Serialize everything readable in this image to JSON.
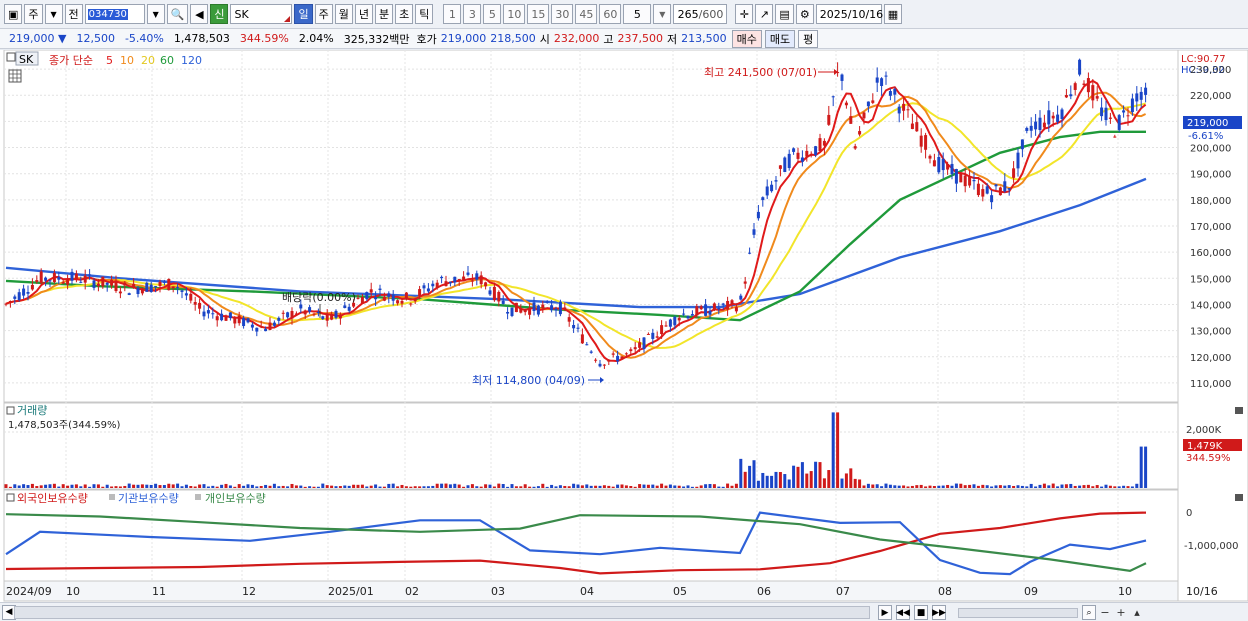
{
  "toolbar": {
    "period_tab": "주",
    "prev_label": "전",
    "code": "034730",
    "stock_name": "SK",
    "new_label": "신",
    "intervals": [
      "일",
      "주",
      "월",
      "년",
      "분",
      "초",
      "틱"
    ],
    "numbers": [
      "1",
      "3",
      "5",
      "10",
      "15",
      "30",
      "45",
      "60"
    ],
    "custom_interval": "5",
    "count": "265",
    "count_max": "/600",
    "date": "2025/10/16"
  },
  "quote": {
    "price": "219,000 ▼",
    "change": "12,500",
    "change_pct": "-5.40%",
    "volume": "1,478,503",
    "volume_ratio": "344.59%",
    "turnover": "2.04%",
    "amount": "325,332백만",
    "bid_label": "호가",
    "bid1": "219,000",
    "bid2": "218,500",
    "open_label": "시",
    "open": "232,000",
    "high_label": "고",
    "high": "237,500",
    "low_label": "저",
    "low": "213,500",
    "buy_label": "매수",
    "sell_label": "매도",
    "avg_label": "평"
  },
  "price_pane": {
    "symbol": "SK",
    "ma_label": "종가 단순",
    "ma_periods": [
      "5",
      "10",
      "20",
      "60",
      "120"
    ],
    "ma_colors": [
      "#e01a1a",
      "#f08a1c",
      "#f2e52a",
      "#1f9a3a",
      "#2f62d8"
    ],
    "lc": "LC:90.77",
    "hc": "HC:-9.32",
    "current_price": "219,000",
    "current_pct": "-6.61%",
    "high_note": "최고 241,500 (07/01)",
    "low_note": "최저 114,800 (04/09)",
    "dividend_note": "배당락(0.00%)",
    "y_ticks": [
      "230,000",
      "220,000",
      "210,000",
      "200,000",
      "190,000",
      "180,000",
      "170,000",
      "160,000",
      "150,000",
      "140,000",
      "130,000",
      "120,000",
      "110,000"
    ]
  },
  "volume_pane": {
    "title": "거래량",
    "value": "1,478,503주(344.59%)",
    "tick": "2,000K",
    "current": "1,479K",
    "current_pct": "344.59%"
  },
  "holding_pane": {
    "legend": [
      "외국인보유수량",
      "기관보유수량",
      "개인보유수량"
    ],
    "colors": [
      "#d01a1a",
      "#2f62d8",
      "#3a8a4a"
    ],
    "ticks": [
      "0",
      "-1,000,000"
    ]
  },
  "x_axis": [
    "2024/09",
    "10",
    "11",
    "12",
    "2025/01",
    "02",
    "03",
    "04",
    "05",
    "06",
    "07",
    "08",
    "09",
    "10",
    "10/16"
  ],
  "colors": {
    "up": "#d01a1a",
    "down": "#1a45c7",
    "grid": "#d8d8d8"
  }
}
